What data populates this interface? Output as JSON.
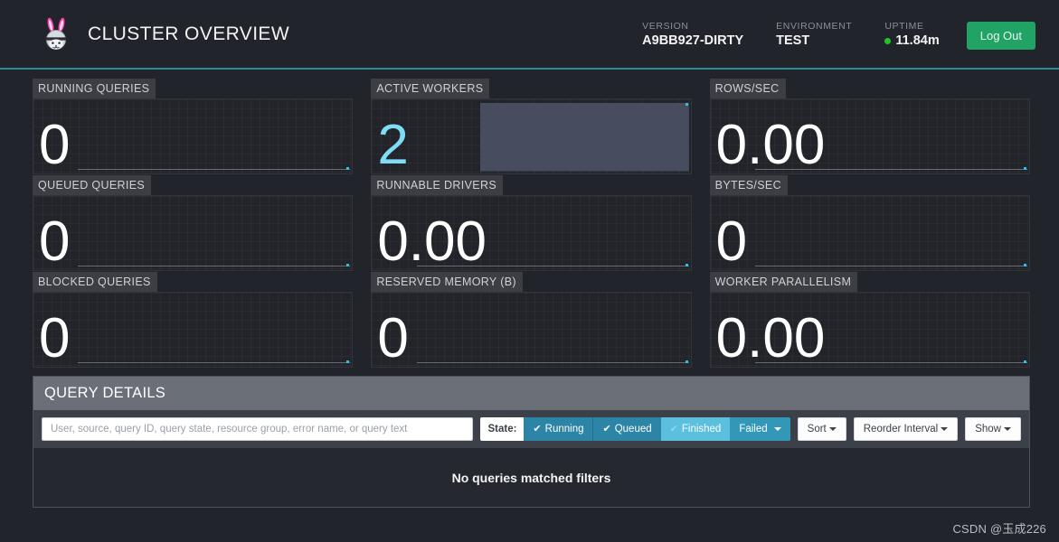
{
  "header": {
    "logo_icon": "trino-rabbit-logo-icon",
    "title": "CLUSTER OVERVIEW",
    "version_label": "VERSION",
    "version_value": "A9BB927-DIRTY",
    "environment_label": "ENVIRONMENT",
    "environment_value": "TEST",
    "uptime_label": "UPTIME",
    "uptime_value": "11.84m",
    "uptime_status_color": "#25c425",
    "logout_label": "Log Out",
    "logout_color": "#21a366",
    "accent_rule_color": "#2e8b96"
  },
  "stats": [
    {
      "label": "RUNNING QUERIES",
      "value": "0",
      "accent": false
    },
    {
      "label": "ACTIVE WORKERS",
      "value": "2",
      "accent": true
    },
    {
      "label": "ROWS/SEC",
      "value": "0.00",
      "accent": false
    },
    {
      "label": "QUEUED QUERIES",
      "value": "0",
      "accent": false
    },
    {
      "label": "RUNNABLE DRIVERS",
      "value": "0.00",
      "accent": false
    },
    {
      "label": "BYTES/SEC",
      "value": "0",
      "accent": false
    },
    {
      "label": "BLOCKED QUERIES",
      "value": "0",
      "accent": false
    },
    {
      "label": "RESERVED MEMORY (B)",
      "value": "0",
      "accent": false
    },
    {
      "label": "WORKER PARALLELISM",
      "value": "0.00",
      "accent": false
    }
  ],
  "chart_data": [
    {
      "type": "line",
      "title": "RUNNING QUERIES",
      "x": [
        0,
        1,
        2,
        3,
        4,
        5,
        6,
        7,
        8,
        9
      ],
      "values": [
        0,
        0,
        0,
        0,
        0,
        0,
        0,
        0,
        0,
        0
      ],
      "ylim": [
        0,
        1
      ],
      "grid": true,
      "marker_color": "#29c3e8"
    },
    {
      "type": "area",
      "title": "ACTIVE WORKERS",
      "x": [
        0,
        1,
        2,
        3,
        4,
        5,
        6,
        7,
        8,
        9
      ],
      "values": [
        2,
        2,
        2,
        2,
        2,
        2,
        2,
        2,
        2,
        2
      ],
      "ylim": [
        0,
        2
      ],
      "grid": false,
      "fill_color": "#474d5e",
      "marker_color": "#29c3e8"
    },
    {
      "type": "line",
      "title": "ROWS/SEC",
      "x": [
        0,
        1,
        2,
        3,
        4,
        5,
        6,
        7,
        8,
        9
      ],
      "values": [
        0,
        0,
        0,
        0,
        0,
        0,
        0,
        0,
        0,
        0
      ],
      "ylim": [
        0,
        1
      ],
      "grid": true,
      "marker_color": "#29c3e8"
    },
    {
      "type": "line",
      "title": "QUEUED QUERIES",
      "x": [
        0,
        1,
        2,
        3,
        4,
        5,
        6,
        7,
        8,
        9
      ],
      "values": [
        0,
        0,
        0,
        0,
        0,
        0,
        0,
        0,
        0,
        0
      ],
      "ylim": [
        0,
        1
      ],
      "grid": true,
      "marker_color": "#29c3e8"
    },
    {
      "type": "line",
      "title": "RUNNABLE DRIVERS",
      "x": [
        0,
        1,
        2,
        3,
        4,
        5,
        6,
        7,
        8,
        9
      ],
      "values": [
        0,
        0,
        0,
        0,
        0,
        0,
        0,
        0,
        0,
        0
      ],
      "ylim": [
        0,
        1
      ],
      "grid": true,
      "marker_color": "#29c3e8"
    },
    {
      "type": "line",
      "title": "BYTES/SEC",
      "x": [
        0,
        1,
        2,
        3,
        4,
        5,
        6,
        7,
        8,
        9
      ],
      "values": [
        0,
        0,
        0,
        0,
        0,
        0,
        0,
        0,
        0,
        0
      ],
      "ylim": [
        0,
        1
      ],
      "grid": true,
      "marker_color": "#29c3e8"
    },
    {
      "type": "line",
      "title": "BLOCKED QUERIES",
      "x": [
        0,
        1,
        2,
        3,
        4,
        5,
        6,
        7,
        8,
        9
      ],
      "values": [
        0,
        0,
        0,
        0,
        0,
        0,
        0,
        0,
        0,
        0
      ],
      "ylim": [
        0,
        1
      ],
      "grid": true,
      "marker_color": "#29c3e8"
    },
    {
      "type": "line",
      "title": "RESERVED MEMORY (B)",
      "x": [
        0,
        1,
        2,
        3,
        4,
        5,
        6,
        7,
        8,
        9
      ],
      "values": [
        0,
        0,
        0,
        0,
        0,
        0,
        0,
        0,
        0,
        0
      ],
      "ylim": [
        0,
        1
      ],
      "grid": true,
      "marker_color": "#29c3e8"
    },
    {
      "type": "line",
      "title": "WORKER PARALLELISM",
      "x": [
        0,
        1,
        2,
        3,
        4,
        5,
        6,
        7,
        8,
        9
      ],
      "values": [
        0,
        0,
        0,
        0,
        0,
        0,
        0,
        0,
        0,
        0
      ],
      "ylim": [
        0,
        1
      ],
      "grid": true,
      "marker_color": "#29c3e8"
    }
  ],
  "query_panel": {
    "heading": "QUERY DETAILS",
    "search_placeholder": "User, source, query ID, query state, resource group, error name, or query text",
    "search_value": "",
    "state_label": "State:",
    "state_filters": [
      {
        "label": "Running",
        "checked": true,
        "state": "active"
      },
      {
        "label": "Queued",
        "checked": true,
        "state": "active"
      },
      {
        "label": "Finished",
        "checked": true,
        "state": "hover"
      },
      {
        "label": "Failed",
        "checked": false,
        "state": "dropdown"
      }
    ],
    "dropdowns": [
      {
        "label": "Sort"
      },
      {
        "label": "Reorder Interval"
      },
      {
        "label": "Show"
      }
    ],
    "empty_message": "No queries matched filters"
  },
  "watermark": "CSDN @玉成226"
}
